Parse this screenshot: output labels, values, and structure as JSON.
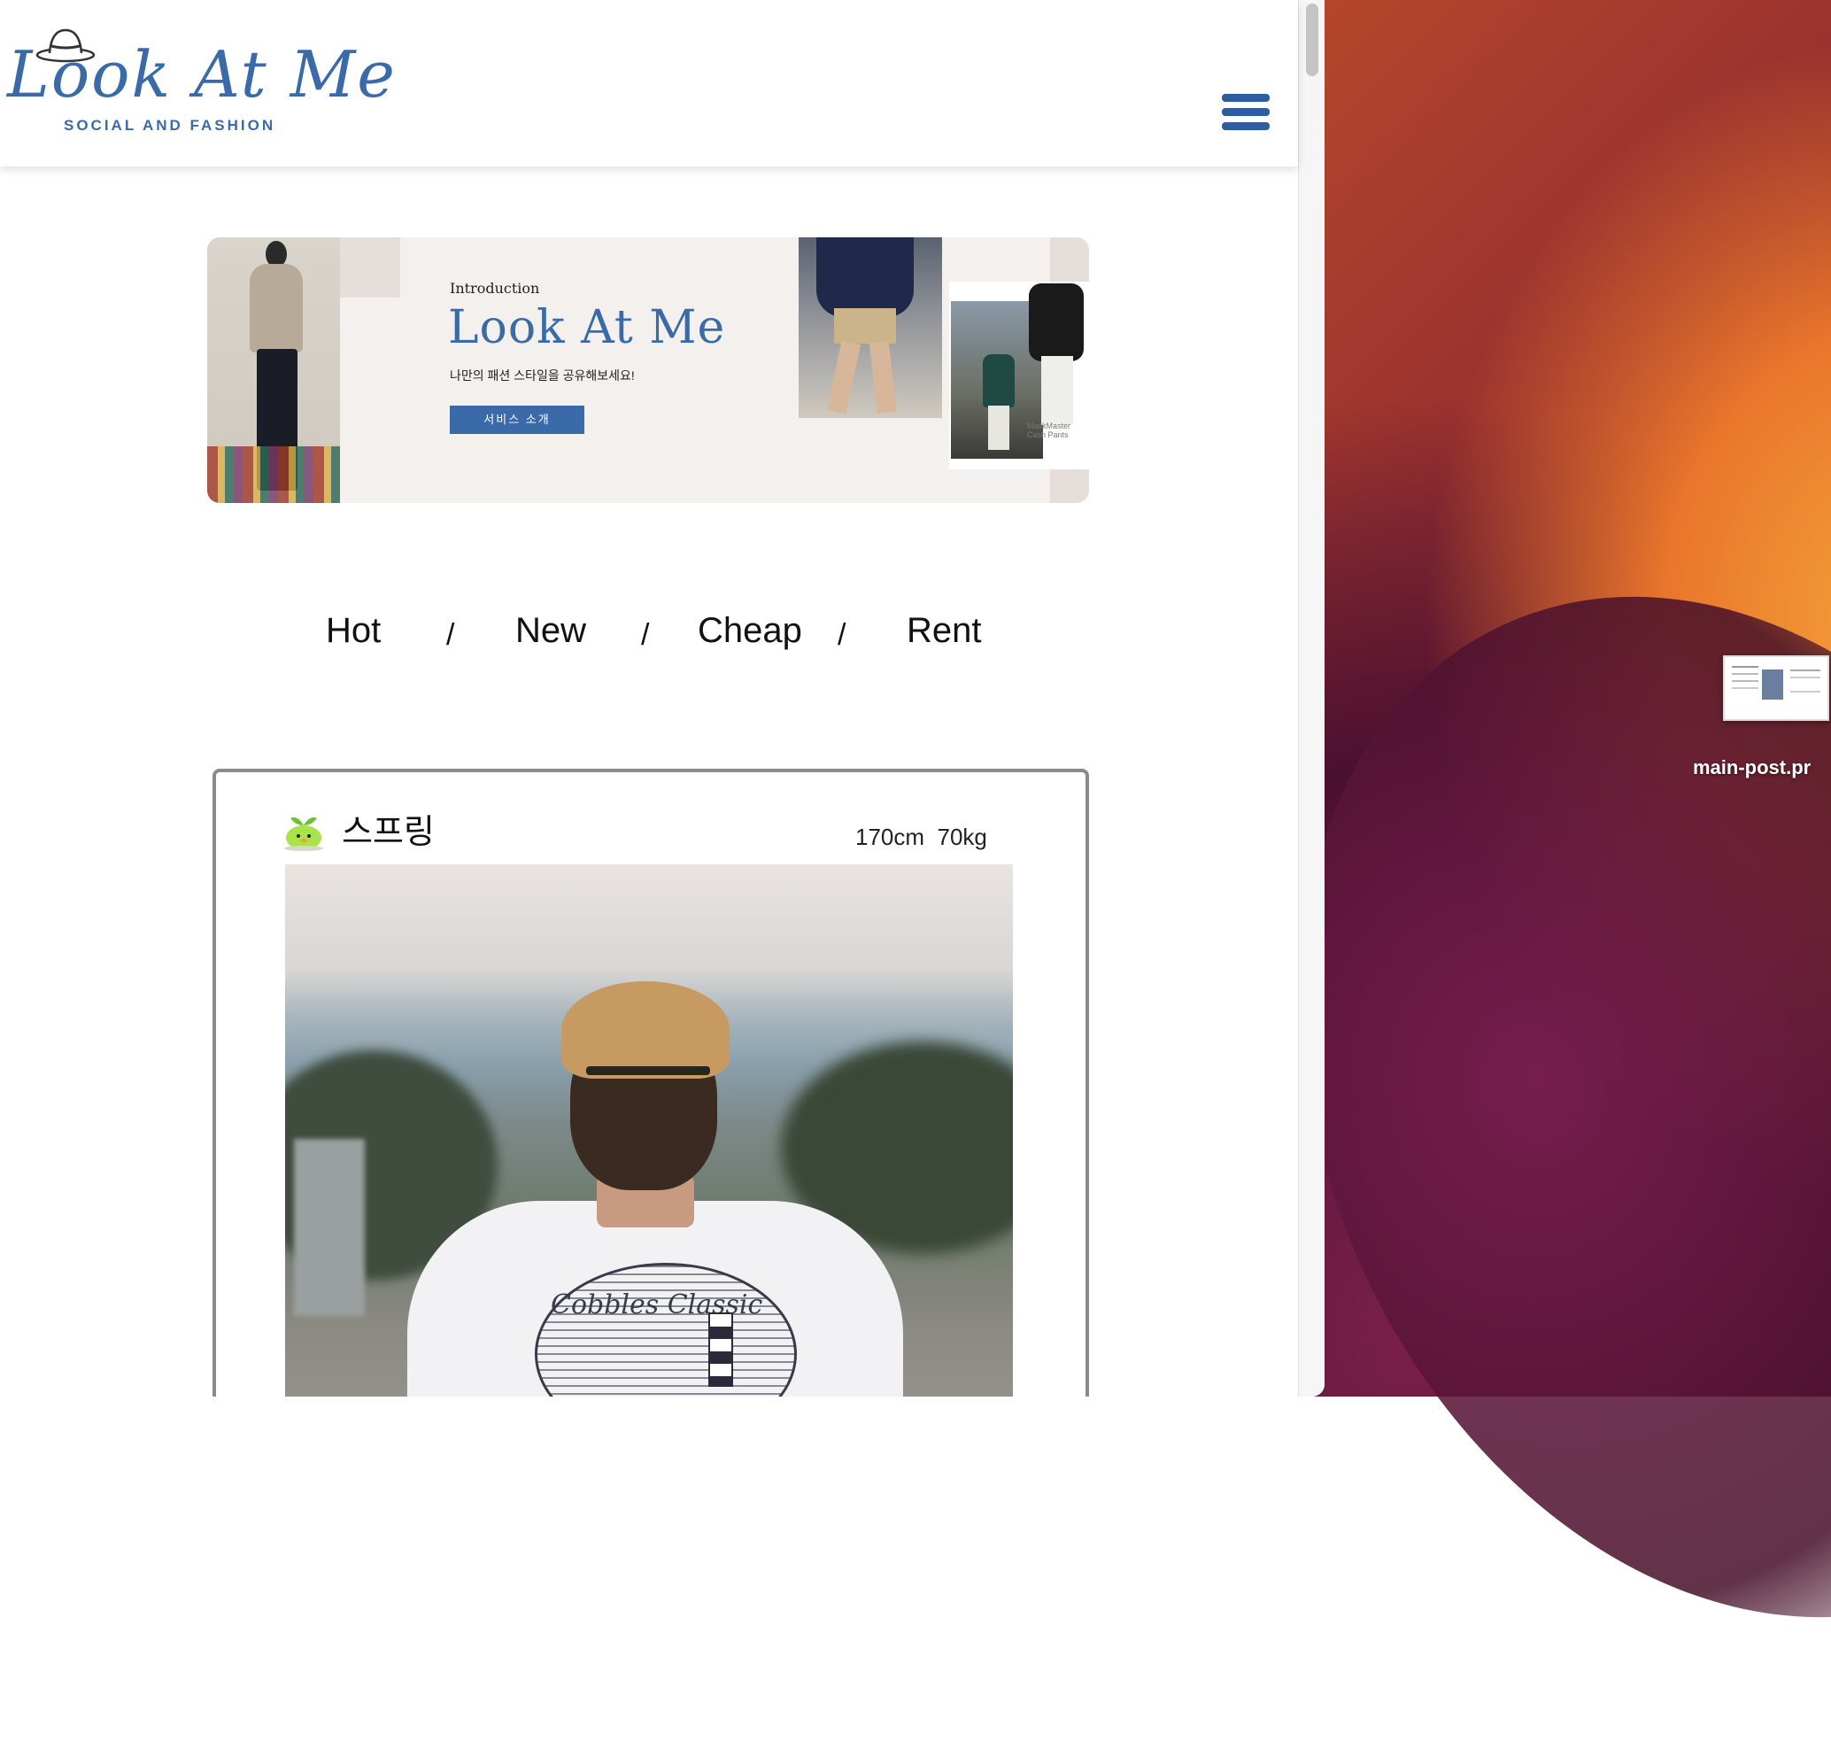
{
  "app": {
    "logo_text": "Look At Me",
    "logo_tagline": "SOCIAL AND FASHION",
    "menu_icon": "hamburger-menu-icon",
    "brand_color": "#3a6ba8"
  },
  "banner": {
    "intro": "Introduction",
    "title": "Look At Me",
    "subtitle": "나만의 패션 스타일을 공유해보세요!",
    "button_label": "서비스 소개",
    "photo_caption": "MaskMaster Cash Pants"
  },
  "tabs": [
    {
      "label": "Hot"
    },
    {
      "label": "New"
    },
    {
      "label": "Cheap"
    },
    {
      "label": "Rent"
    }
  ],
  "tab_separator": "/",
  "post": {
    "username": "스프링",
    "height": "170cm",
    "weight": "70kg",
    "avatar_icon": "sprout-avatar-icon",
    "shirt_print_text": "Cobbles Classic"
  },
  "desktop": {
    "file_label": "main-post.pr"
  }
}
